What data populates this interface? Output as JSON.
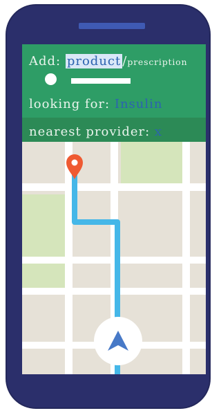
{
  "header": {
    "add_label": "Add:",
    "add_selected": "product",
    "add_separator": "/",
    "add_option": "prescription",
    "looking_label": "looking for:",
    "looking_value": "Insulin",
    "provider_label": "nearest provider:",
    "provider_value": "x"
  },
  "icons": {
    "location_pin": "map-pin-icon",
    "navigation": "navigation-arrow-icon"
  },
  "colors": {
    "phone_body": "#2b2f6b",
    "speaker": "#3f5ab3",
    "header_green": "#2e9d66",
    "provider_green": "#2c8a56",
    "route_blue": "#45b7e8",
    "pin_red": "#ef5a32",
    "accent_blue": "#2c63b0"
  }
}
